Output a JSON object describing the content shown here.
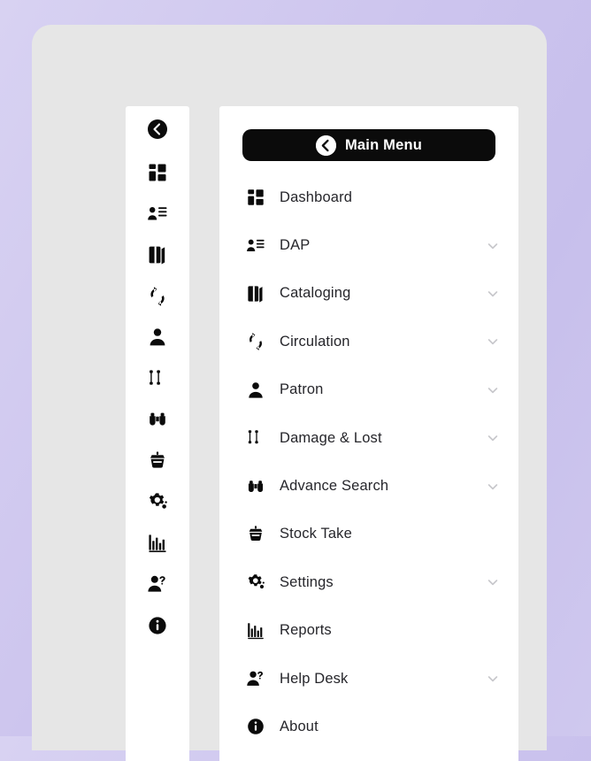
{
  "theme": {
    "background_gradient_start": "#d8d2f2",
    "background_gradient_end": "#c7bfec",
    "card_background": "#e6e6e6",
    "panel_background": "#ffffff",
    "header_pill_background": "#0b0b0b",
    "header_pill_text": "#ffffff",
    "menu_text": "#26262b",
    "caret_color": "#c8c8cc"
  },
  "header": {
    "title": "Main Menu",
    "back_icon": "chevron-left-circle-icon"
  },
  "rail": {
    "collapse_icon": "chevron-left-circle-icon",
    "items": [
      {
        "icon": "dashboard-grid-icon",
        "label": "Dashboard"
      },
      {
        "icon": "dap-user-list-icon",
        "label": "DAP"
      },
      {
        "icon": "cataloging-book-icon",
        "label": "Cataloging"
      },
      {
        "icon": "circulation-arrows-icon",
        "label": "Circulation"
      },
      {
        "icon": "patron-user-icon",
        "label": "Patron"
      },
      {
        "icon": "damage-lost-icon",
        "label": "Damage & Lost"
      },
      {
        "icon": "advance-search-binoculars-icon",
        "label": "Advance Search"
      },
      {
        "icon": "stock-take-icon",
        "label": "Stock Take"
      },
      {
        "icon": "settings-gear-icon",
        "label": "Settings"
      },
      {
        "icon": "reports-chart-icon",
        "label": "Reports"
      },
      {
        "icon": "help-desk-user-icon",
        "label": "Help Desk"
      },
      {
        "icon": "about-info-icon",
        "label": "About"
      }
    ]
  },
  "menu": {
    "items": [
      {
        "label": "Dashboard",
        "icon": "dashboard-grid-icon",
        "expandable": false
      },
      {
        "label": "DAP",
        "icon": "dap-user-list-icon",
        "expandable": true
      },
      {
        "label": "Cataloging",
        "icon": "cataloging-book-icon",
        "expandable": true
      },
      {
        "label": "Circulation",
        "icon": "circulation-arrows-icon",
        "expandable": true
      },
      {
        "label": "Patron",
        "icon": "patron-user-icon",
        "expandable": true
      },
      {
        "label": "Damage & Lost",
        "icon": "damage-lost-icon",
        "expandable": true
      },
      {
        "label": "Advance Search",
        "icon": "advance-search-binoculars-icon",
        "expandable": true
      },
      {
        "label": "Stock Take",
        "icon": "stock-take-icon",
        "expandable": false
      },
      {
        "label": "Settings",
        "icon": "settings-gear-icon",
        "expandable": true
      },
      {
        "label": "Reports",
        "icon": "reports-chart-icon",
        "expandable": false
      },
      {
        "label": "Help Desk",
        "icon": "help-desk-user-icon",
        "expandable": true
      },
      {
        "label": "About",
        "icon": "about-info-icon",
        "expandable": false
      }
    ]
  }
}
